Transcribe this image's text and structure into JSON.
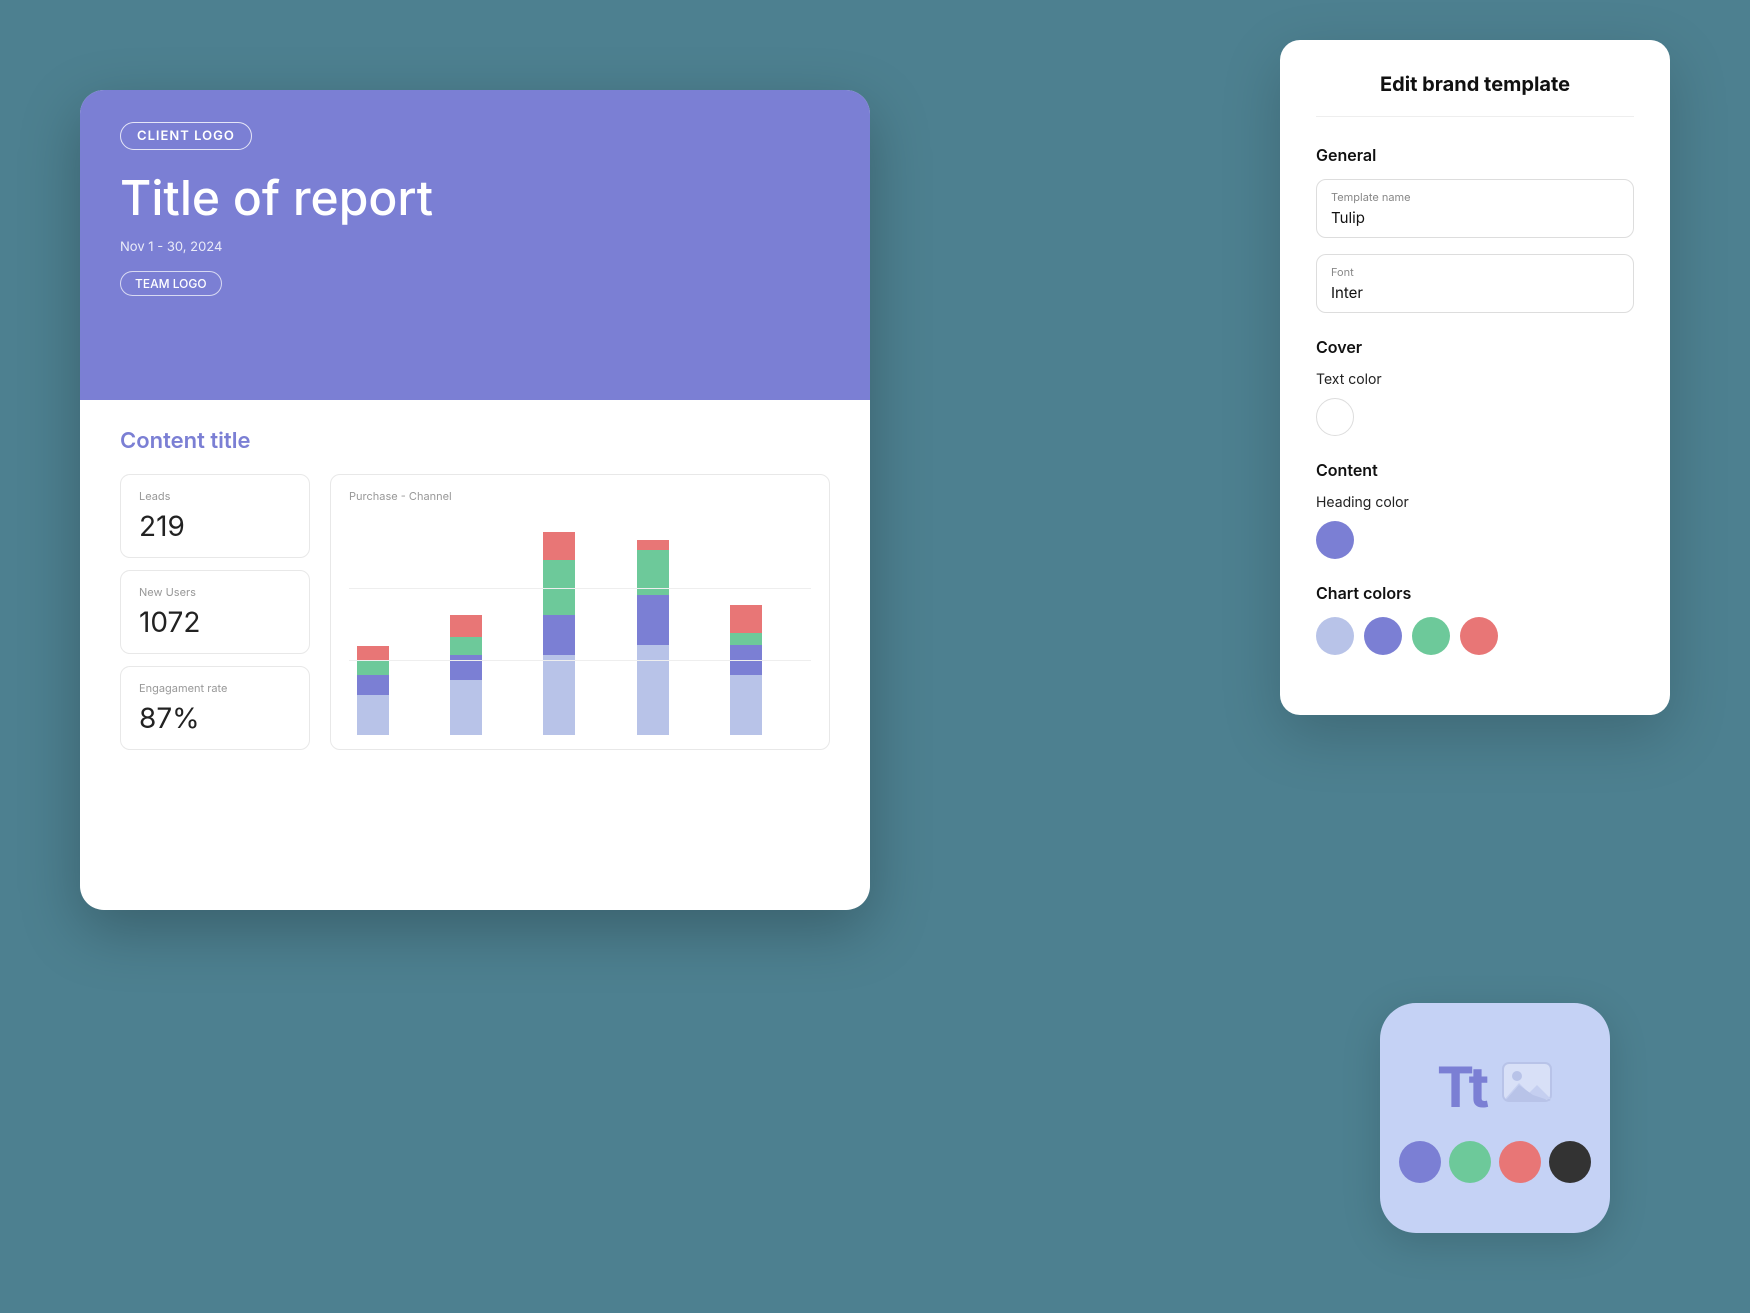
{
  "background": {
    "color": "#4d8090"
  },
  "report_card": {
    "cover": {
      "client_logo_label": "CLIENT LOGO",
      "title": "Title of report",
      "date": "Nov 1 - 30, 2024",
      "team_logo_label": "TEAM LOGO",
      "bg_color": "#7b7fd4"
    },
    "content": {
      "section_title": "Content title",
      "metrics": [
        {
          "label": "Leads",
          "value": "219"
        },
        {
          "label": "New Users",
          "value": "1072"
        },
        {
          "label": "Engagament rate",
          "value": "87%"
        }
      ],
      "chart": {
        "label": "Purchase - Channel",
        "bars": [
          {
            "light_blue": 40,
            "blue": 20,
            "green": 15,
            "red": 14
          },
          {
            "light_blue": 55,
            "blue": 25,
            "green": 18,
            "red": 22
          },
          {
            "light_blue": 80,
            "blue": 40,
            "green": 35,
            "red": 38
          },
          {
            "light_blue": 90,
            "blue": 50,
            "green": 45,
            "red": 10
          },
          {
            "light_blue": 60,
            "blue": 30,
            "green": 12,
            "red": 28
          }
        ]
      }
    }
  },
  "edit_panel": {
    "title": "Edit brand template",
    "general": {
      "heading": "General",
      "template_name_label": "Template name",
      "template_name_value": "Tulip",
      "font_label": "Font",
      "font_value": "Inter"
    },
    "cover": {
      "heading": "Cover",
      "text_color_label": "Text color",
      "text_color_value": "#ffffff"
    },
    "content": {
      "heading": "Content",
      "heading_color_label": "Heading color",
      "heading_color_value": "#7b7fd4"
    },
    "chart_colors": {
      "label": "Chart colors",
      "colors": [
        "#b8c3e8",
        "#7b7fd4",
        "#6dc99a",
        "#e87676"
      ]
    }
  },
  "brand_icon": {
    "tt_text": "Tt",
    "colors": [
      "#7b7fd4",
      "#6dc99a",
      "#e87676",
      "#333"
    ]
  }
}
